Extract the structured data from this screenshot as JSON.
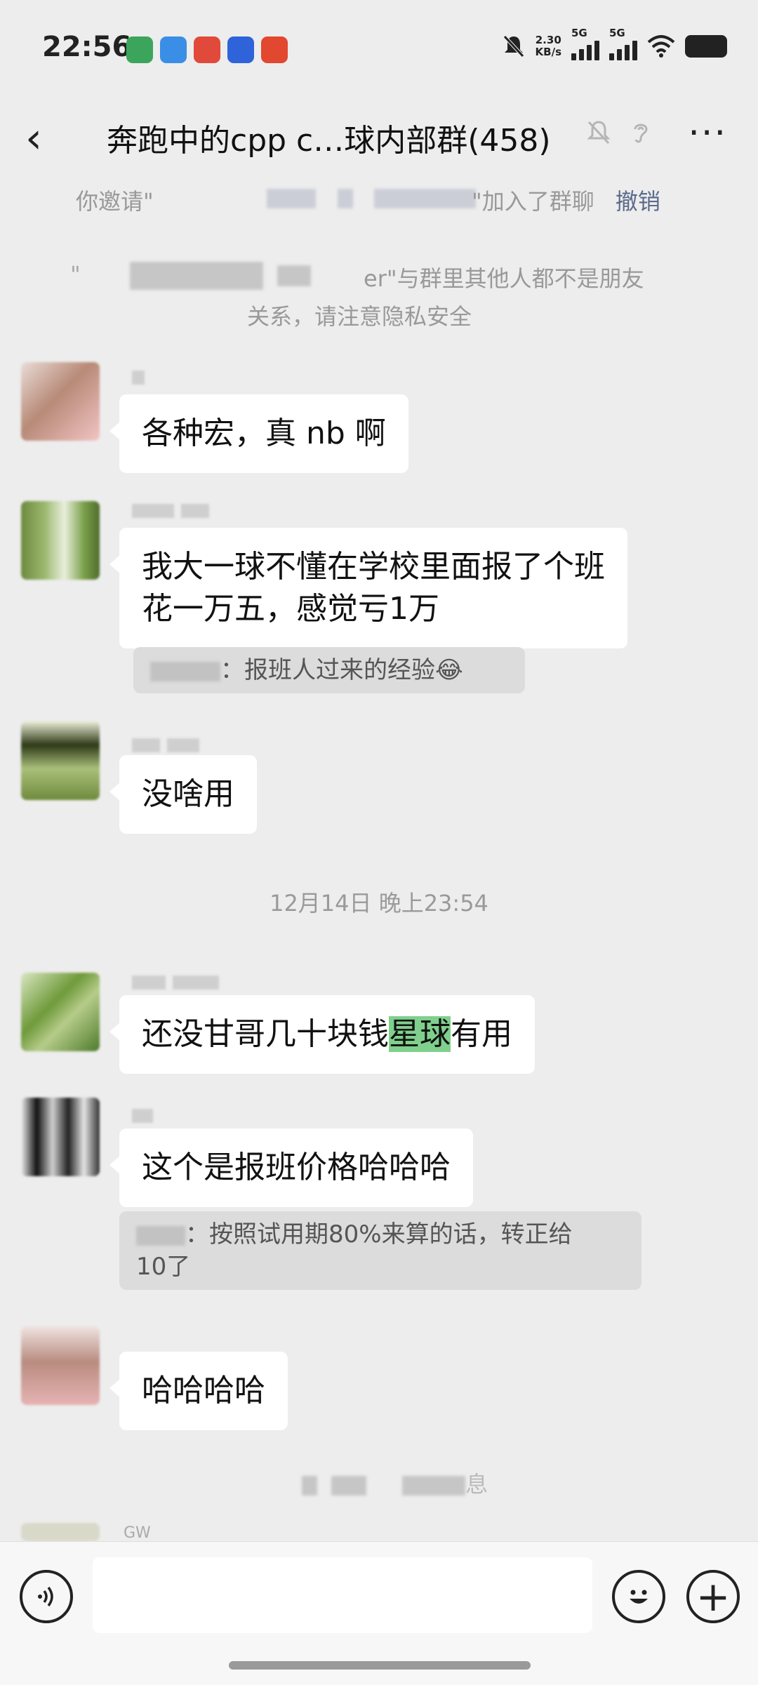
{
  "status_bar": {
    "time": "22:56",
    "net_speed_value": "2.30",
    "net_speed_unit": "KB/s",
    "sim1": "5G",
    "sim2": "5G"
  },
  "header": {
    "title": "奔跑中的cpp c…球内部群(458)"
  },
  "system": {
    "invite_prefix": "你邀请\"",
    "invite_suffix": "\"加入了群聊",
    "revoke_label": "撤销",
    "privacy_line1": "er\"与群里其他人都不是朋友",
    "privacy_line2": "关系，请注意隐私安全"
  },
  "messages": [
    {
      "text": "各种宏，真 nb 啊"
    },
    {
      "text_line1": "我大一球不懂在学校里面报了个班",
      "text_line2": "花一万五，感觉亏1万",
      "quote": "：报班人过来的经验😂"
    },
    {
      "text": "没啥用"
    },
    {
      "text_before": "还没甘哥几十块钱",
      "highlight": "星球",
      "text_after": "有用"
    },
    {
      "text": "这个是报班价格哈哈哈",
      "quote_line1": "：按照试用期80%来算的话，转正给",
      "quote_line2": "10了"
    },
    {
      "text": "哈哈哈哈"
    }
  ],
  "timestamp": "12月14日 晚上23:54",
  "bottom_notice": "息",
  "partial_nick": "GW",
  "input": {
    "placeholder": ""
  },
  "colors": {
    "highlight": "#7fd08c",
    "link": "#5b6b8c",
    "background": "#ededed"
  },
  "icons": [
    "back-icon",
    "mute-icon",
    "ear-icon",
    "more-icon",
    "voice-icon",
    "emoji-icon",
    "plus-icon"
  ]
}
